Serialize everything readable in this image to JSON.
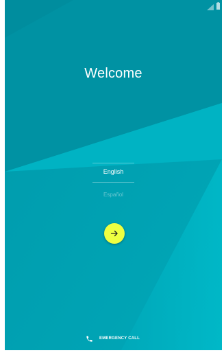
{
  "welcome": {
    "title": "Welcome"
  },
  "language_picker": {
    "selected": "English",
    "options": [
      "English",
      "Español"
    ]
  },
  "next_button": {
    "icon": "arrow-right-icon"
  },
  "emergency": {
    "label": "EMERGENCY CALL",
    "icon": "phone-icon"
  },
  "status_bar": {
    "icons": [
      "signal-icon",
      "battery-icon"
    ]
  },
  "colors": {
    "background": "#0097a7",
    "accent": "#eeff41",
    "text": "#ffffff"
  }
}
